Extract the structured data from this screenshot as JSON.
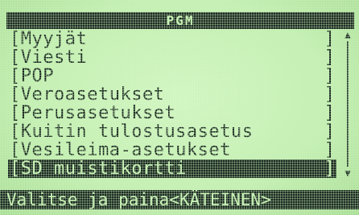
{
  "header": {
    "title": "PGM"
  },
  "menu": {
    "items": [
      {
        "label": "[Myyjät",
        "close": "]"
      },
      {
        "label": "[Viesti",
        "close": "]"
      },
      {
        "label": "[POP",
        "close": "]"
      },
      {
        "label": "[Veroasetukset",
        "close": "]"
      },
      {
        "label": "[Perusasetukset",
        "close": "]"
      },
      {
        "label": "[Kuitin tulostusasetus",
        "close": "]"
      },
      {
        "label": "[Vesileima-asetukset",
        "close": "]"
      },
      {
        "label": "[SD muistikortti",
        "close": "]"
      }
    ],
    "selected_index": 7
  },
  "scrollbar": {
    "up_icon": "scroll-up-arrow-icon",
    "down_icon": "scroll-down-arrow-icon"
  },
  "status": {
    "text": "Valitse ja paina<KÄTEINEN>"
  },
  "colors": {
    "background": "#c6f0b4",
    "foreground": "#1c2a22",
    "inverse_text": "#c9f2b6"
  }
}
